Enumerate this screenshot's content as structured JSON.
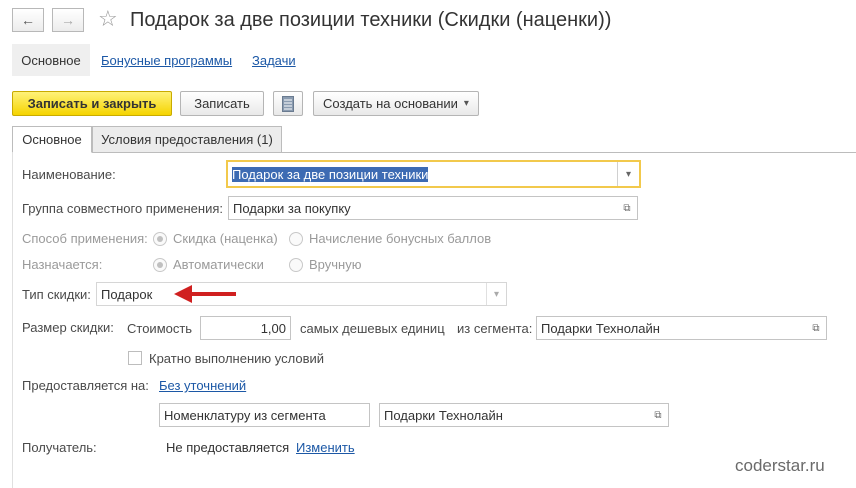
{
  "window": {
    "title": "Подарок за две позиции техники (Скидки (наценки))"
  },
  "nav": {
    "back_glyph": "←",
    "forward_glyph": "→",
    "star_glyph": "☆"
  },
  "sections": {
    "main": "Основное",
    "bonus": "Бонусные программы",
    "tasks": "Задачи"
  },
  "toolbar": {
    "save_close": "Записать и закрыть",
    "save": "Записать",
    "create_based": "Создать на основании",
    "dropdown_glyph": "▾"
  },
  "tabs": {
    "main": "Основное",
    "conditions": "Условия предоставления (1)"
  },
  "form": {
    "name_label": "Наименование:",
    "name_value": "Подарок за две позиции техники",
    "group_label": "Группа совместного применения:",
    "group_value": "Подарки за покупку",
    "method_label": "Способ применения:",
    "method_opt1": "Скидка (наценка)",
    "method_opt2": "Начисление бонусных баллов",
    "assigned_label": "Назначается:",
    "assigned_opt1": "Автоматически",
    "assigned_opt2": "Вручную",
    "type_label": "Тип скидки:",
    "type_value": "Подарок",
    "size_label": "Размер скидки:",
    "cost_label": "Стоимость",
    "cost_value": "1,00",
    "cheapest_label": "самых дешевых единиц",
    "segment_label": "из сегмента:",
    "segment_value": "Подарки Технолайн",
    "multiple_label": "Кратно выполнению условий",
    "provided_label": "Предоставляется на:",
    "provided_link": "Без уточнений",
    "nomenclature_value": "Номенклатуру из сегмента",
    "nomenclature_segment": "Подарки Технолайн",
    "recipient_label": "Получатель:",
    "recipient_value": "Не предоставляется",
    "recipient_change": "Изменить"
  },
  "icons": {
    "open": "⧉",
    "dropdown": "▾"
  },
  "watermark": "coderstar.ru",
  "colors": {
    "accent_yellow": "#f5d400",
    "focus_border": "#f2c94c",
    "selection": "#3d6bb3",
    "link": "#1c58a6",
    "arrow": "#d02020"
  }
}
